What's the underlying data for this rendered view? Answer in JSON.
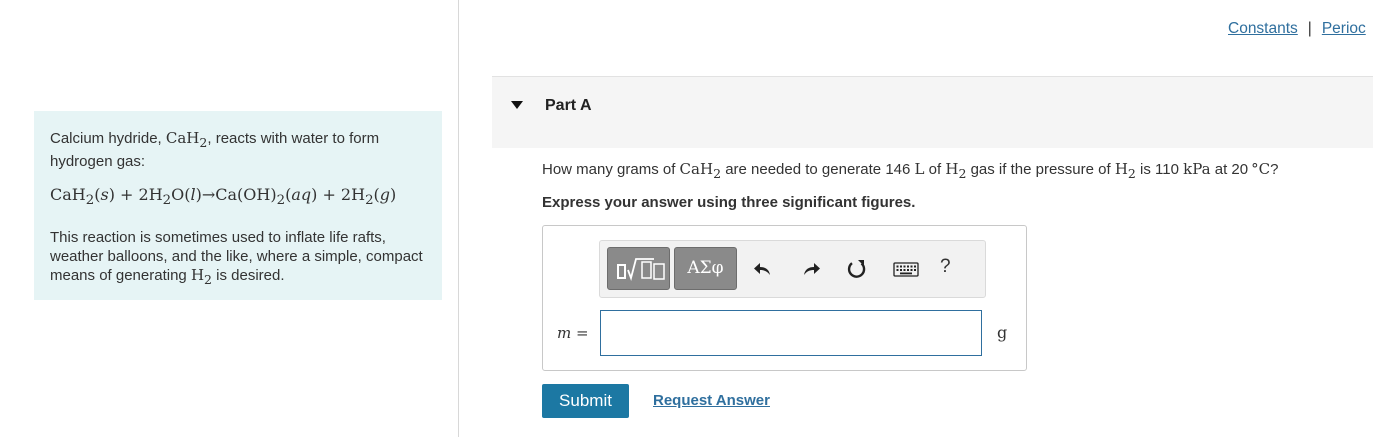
{
  "links": {
    "constants": "Constants",
    "separator": "|",
    "periodic": "Perioc"
  },
  "intro": {
    "p1_a": "Calcium hydride,",
    "p1_formula": "CaH",
    "p1_formula_sub": "2",
    "p1_b": ", reacts with water to form hydrogen gas:",
    "p2_a": "This reaction is sometimes used to inflate life rafts, weather balloons, and the like, where a simple, compact means of generating",
    "p2_formula": "H",
    "p2_formula_sub": "2",
    "p2_b": "is desired."
  },
  "part": {
    "title": "Part A"
  },
  "question": {
    "a": "How many grams of",
    "b": "are needed to generate 146",
    "liters": "L",
    "c": "of",
    "d": "gas if the pressure of",
    "e": "is 110",
    "kpa": "kPa",
    "f": "at 20",
    "deg": "°C",
    "g": "?"
  },
  "instruction": "Express your answer using three significant figures.",
  "toolbar": {
    "greek": "ΑΣφ",
    "help": "?",
    "icons": [
      "templates-icon",
      "greek-symbols-icon",
      "undo-icon",
      "redo-icon",
      "reset-icon",
      "keyboard-icon",
      "help-icon"
    ]
  },
  "answer": {
    "label": "m =",
    "value": "",
    "unit": "g"
  },
  "buttons": {
    "submit": "Submit",
    "request": "Request Answer"
  },
  "colors": {
    "accent": "#1c78a3",
    "link": "#2f6f9e",
    "intro_bg": "#e6f4f5",
    "toolbar_btn": "#8a8a8a"
  }
}
